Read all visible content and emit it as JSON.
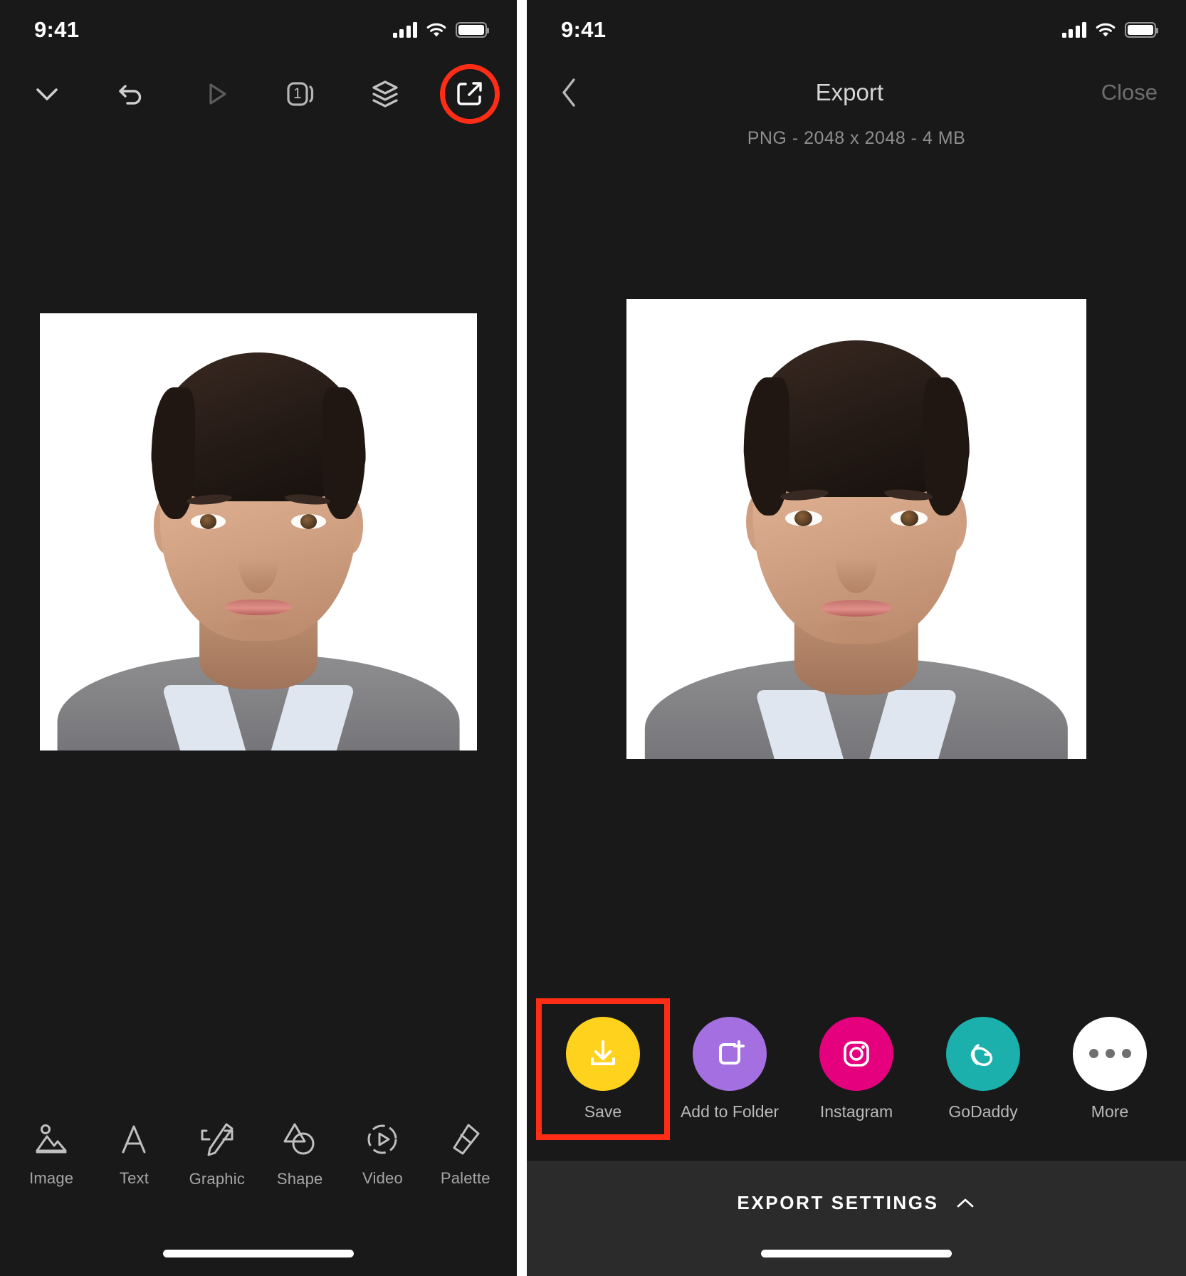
{
  "statusbar": {
    "time": "9:41",
    "icons": [
      "cellular-signal-icon",
      "wifi-icon",
      "battery-icon"
    ]
  },
  "editor": {
    "toolbar": [
      {
        "name": "collapse-chevron-down",
        "icon": "chevron-down-icon",
        "label": ""
      },
      {
        "name": "undo",
        "icon": "undo-icon",
        "label": ""
      },
      {
        "name": "play-preview",
        "icon": "play-icon",
        "label": ""
      },
      {
        "name": "pages",
        "icon": "pages-icon",
        "label": "1"
      },
      {
        "name": "layers",
        "icon": "layers-icon",
        "label": ""
      },
      {
        "name": "share-export",
        "icon": "share-export-icon",
        "label": ""
      }
    ],
    "highlighted_tool": "share-export",
    "tools": [
      {
        "label": "Image",
        "icon": "image-icon"
      },
      {
        "label": "Text",
        "icon": "text-a-icon"
      },
      {
        "label": "Graphic",
        "icon": "graphic-pen-icon"
      },
      {
        "label": "Shape",
        "icon": "shape-icon"
      },
      {
        "label": "Video",
        "icon": "video-play-icon"
      },
      {
        "label": "Palette",
        "icon": "palette-icon"
      }
    ]
  },
  "export": {
    "back_icon": "chevron-left-icon",
    "title": "Export",
    "close_label": "Close",
    "file_info": "PNG - 2048 x 2048 - 4 MB",
    "share_targets": [
      {
        "label": "Save",
        "icon": "download-icon",
        "color": "#FFD21E",
        "highlighted": true
      },
      {
        "label": "Add to Folder",
        "icon": "add-to-folder-icon",
        "color": "#A46FE0",
        "highlighted": false
      },
      {
        "label": "Instagram",
        "icon": "instagram-icon",
        "color": "#E5007E",
        "highlighted": false
      },
      {
        "label": "GoDaddy",
        "icon": "godaddy-icon",
        "color": "#1BB0AC",
        "highlighted": false
      },
      {
        "label": "More",
        "icon": "more-dots-icon",
        "color": "#FFFFFF",
        "highlighted": false
      }
    ],
    "settings_label": "EXPORT SETTINGS",
    "settings_chevron": "chevron-up-icon"
  },
  "colors": {
    "highlight": "#FF2D15",
    "app_bg": "#191919",
    "panel_bg": "#2B2B2B"
  },
  "artwork": {
    "alt": "portrait photo of a man on white background"
  }
}
